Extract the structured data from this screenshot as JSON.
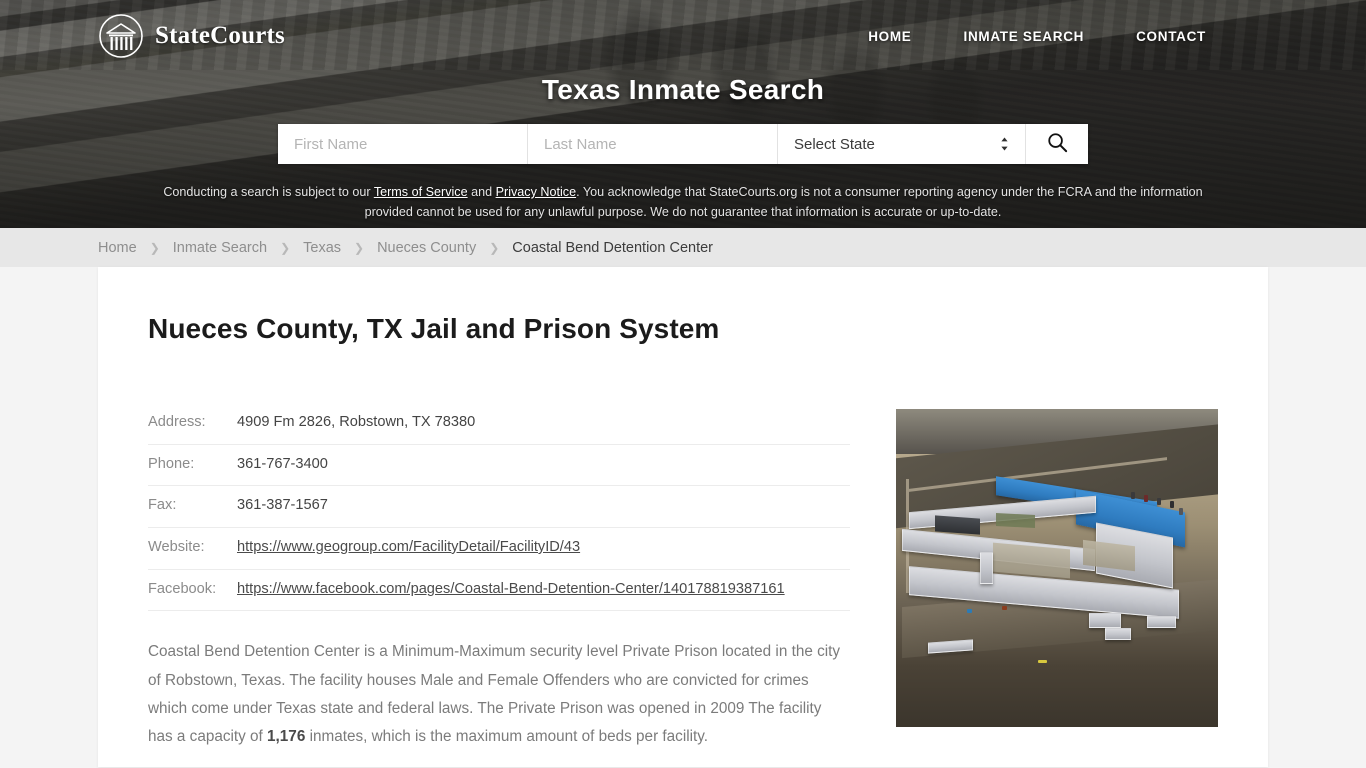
{
  "header": {
    "brand": "StateCourts",
    "brand_icon": "courthouse-circle-logo",
    "nav": [
      {
        "label": "HOME"
      },
      {
        "label": "INMATE SEARCH"
      },
      {
        "label": "CONTACT"
      }
    ],
    "hero_title": "Texas Inmate Search",
    "search": {
      "first_name_placeholder": "First Name",
      "first_name_value": "",
      "last_name_placeholder": "Last Name",
      "last_name_value": "",
      "state_selected": "Select State",
      "search_icon": "magnifier-icon"
    },
    "disclaimer": {
      "part1": "Conducting a search is subject to our ",
      "link1": "Terms of Service",
      "part2": " and ",
      "link2": "Privacy Notice",
      "part3": ". You acknowledge that StateCourts.org is not a consumer reporting agency under the FCRA and the information provided cannot be used for any unlawful purpose. We do not guarantee that information is accurate or up-to-date."
    }
  },
  "breadcrumb": {
    "separator": "❯",
    "items": [
      {
        "label": "Home",
        "current": false
      },
      {
        "label": "Inmate Search",
        "current": false
      },
      {
        "label": "Texas",
        "current": false
      },
      {
        "label": "Nueces County",
        "current": false
      },
      {
        "label": "Coastal Bend Detention Center",
        "current": true
      }
    ]
  },
  "main": {
    "page_title": "Nueces County, TX Jail and Prison System",
    "details": [
      {
        "label": "Address:",
        "value": "4909 Fm 2826, Robstown, TX 78380",
        "is_link": false
      },
      {
        "label": "Phone:",
        "value": "361-767-3400",
        "is_link": false
      },
      {
        "label": "Fax:",
        "value": "361-387-1567",
        "is_link": false
      },
      {
        "label": "Website:",
        "value": "https://www.geogroup.com/FacilityDetail/FacilityID/43",
        "is_link": true
      },
      {
        "label": "Facebook:",
        "value": "https://www.facebook.com/pages/Coastal-Bend-Detention-Center/140178819387161",
        "is_link": true
      }
    ],
    "description": {
      "lead": "Coastal Bend Detention Center is a Minimum-Maximum security level Private Prison located in the city of Robstown, Texas. The facility houses Male and Female Offenders who are convicted for crimes which come under Texas state and federal laws. The Private Prison was opened in 2009 The facility has a capacity of ",
      "capacity": "1,176",
      "tail": " inmates, which is the maximum amount of beds per facility."
    },
    "photo_alt": "aerial-view-coastal-bend-detention-center"
  }
}
